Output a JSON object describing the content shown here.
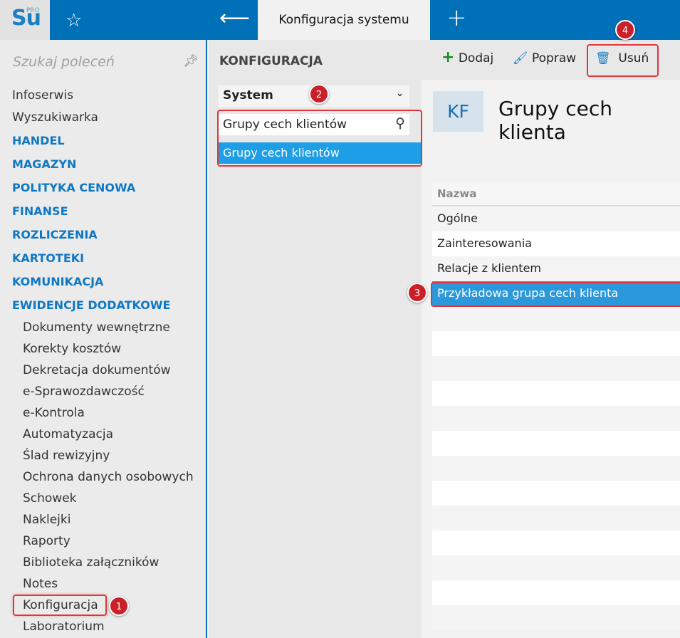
{
  "app": {
    "logo": "Su",
    "logo_sup": "PRO",
    "tab": "Konfiguracja systemu"
  },
  "sidebar": {
    "search_placeholder": "Szukaj poleceń",
    "top_items": [
      "Infoserwis",
      "Wyszukiwarka"
    ],
    "sections": [
      "HANDEL",
      "MAGAZYN",
      "POLITYKA CENOWA",
      "FINANSE",
      "ROZLICZENIA",
      "KARTOTEKI",
      "KOMUNIKACJA",
      "EWIDENCJE DODATKOWE"
    ],
    "sub_items": [
      "Dokumenty wewnętrzne",
      "Korekty kosztów",
      "Dekretacja dokumentów",
      "e-Sprawozdawczość",
      "e-Kontrola",
      "Automatyzacja",
      "Ślad rewizyjny",
      "Ochrona danych osobowych",
      "Schowek",
      "Naklejki",
      "Raporty",
      "Biblioteka załączników",
      "Notes",
      "Konfiguracja",
      "Laboratorium"
    ]
  },
  "middle": {
    "title": "KONFIGURACJA",
    "select": "System",
    "filter": "Grupy cech klientów",
    "option": "Grupy cech klientów"
  },
  "toolbar": {
    "add": "Dodaj",
    "edit": "Popraw",
    "delete": "Usuń"
  },
  "content": {
    "badge": "KF",
    "title": "Grupy cech klienta",
    "column": "Nazwa",
    "rows": [
      "Ogólne",
      "Zainteresowania",
      "Relacje z klientem",
      "Przykładowa grupa cech klienta"
    ]
  },
  "annotations": [
    "1",
    "2",
    "3",
    "4"
  ]
}
